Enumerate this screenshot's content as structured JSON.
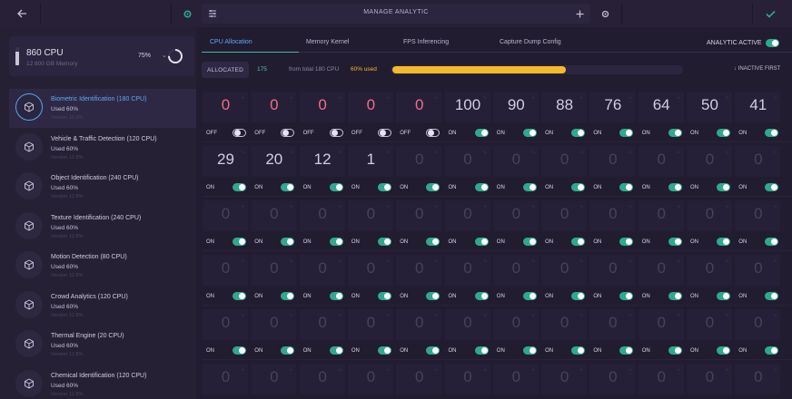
{
  "topbar": {
    "back_icon": "arrow-left-icon",
    "status_icon": "gear-icon",
    "menu_icon": "sliders-icon",
    "title": "MANAGE ANALYTIC",
    "add_icon": "plus-icon",
    "settings_icon": "gear-icon",
    "confirm_icon": "check-icon"
  },
  "cpu_card": {
    "title": "860 CPU",
    "memory": "12 800 GB Memory",
    "percent": "75%",
    "usage_fraction": 0.75
  },
  "analytics": [
    {
      "name": "Biometric Identification (180 CPU)",
      "used": "Used 60%",
      "version": "Version 12.8%",
      "active": true
    },
    {
      "name": "Vehicle & Traffic Detection (120 CPU)",
      "used": "Used 60%",
      "version": "Version 12.8%",
      "active": false
    },
    {
      "name": "Object Identification (240 CPU)",
      "used": "Used 60%",
      "version": "Version 12.8%",
      "active": false
    },
    {
      "name": "Texture Identification (240 CPU)",
      "used": "Used 60%",
      "version": "Version 12.8%",
      "active": false
    },
    {
      "name": "Motion Detection (80 CPU)",
      "used": "Used 60%",
      "version": "Version 12.8%",
      "active": false
    },
    {
      "name": "Crowd Analytics (120 CPU)",
      "used": "Used 60%",
      "version": "Version 12.8%",
      "active": false
    },
    {
      "name": "Thermal Engine (20 CPU)",
      "used": "Used 60%",
      "version": "Version 12.8%",
      "active": false
    },
    {
      "name": "Chemical Identification (120 CPU)",
      "used": "Used 60%",
      "version": "Version 12.8%",
      "active": false
    }
  ],
  "tabs": [
    {
      "label": "CPU Allocation",
      "active": true
    },
    {
      "label": "Memory Kernel",
      "active": false
    },
    {
      "label": "FPS Inferencing",
      "active": false
    },
    {
      "label": "Capture Dump Config",
      "active": false
    }
  ],
  "analytic_active": {
    "label": "ANALYTIC ACTIVE",
    "on": true
  },
  "allocation": {
    "chip": "ALLOCATED",
    "count": "175",
    "total": "from total 180 CPU",
    "used": "60% used",
    "used_fraction": 0.6,
    "sort_label": "↓ INACTIVE FIRST"
  },
  "grid": {
    "on_label": "ON",
    "off_label": "OFF",
    "cell_tag": "%",
    "rows": [
      [
        {
          "v": "0",
          "style": "red",
          "on": false
        },
        {
          "v": "0",
          "style": "red",
          "on": false
        },
        {
          "v": "0",
          "style": "red",
          "on": false
        },
        {
          "v": "0",
          "style": "red",
          "on": false
        },
        {
          "v": "0",
          "style": "red",
          "on": false
        },
        {
          "v": "100",
          "style": "normal",
          "on": true
        },
        {
          "v": "90",
          "style": "normal",
          "on": true
        },
        {
          "v": "88",
          "style": "normal",
          "on": true
        },
        {
          "v": "76",
          "style": "normal",
          "on": true
        },
        {
          "v": "64",
          "style": "normal",
          "on": true
        },
        {
          "v": "50",
          "style": "normal",
          "on": true
        },
        {
          "v": "41",
          "style": "normal",
          "on": true
        }
      ],
      [
        {
          "v": "29",
          "style": "normal",
          "on": true
        },
        {
          "v": "20",
          "style": "normal",
          "on": true
        },
        {
          "v": "12",
          "style": "normal",
          "on": true
        },
        {
          "v": "1",
          "style": "normal",
          "on": true
        },
        {
          "v": "0",
          "style": "dim",
          "on": true
        },
        {
          "v": "0",
          "style": "dim",
          "on": true
        },
        {
          "v": "0",
          "style": "dim",
          "on": true
        },
        {
          "v": "0",
          "style": "dim",
          "on": true
        },
        {
          "v": "0",
          "style": "dim",
          "on": true
        },
        {
          "v": "0",
          "style": "dim",
          "on": true
        },
        {
          "v": "0",
          "style": "dim",
          "on": true
        },
        {
          "v": "0",
          "style": "dim",
          "on": true
        }
      ],
      [
        {
          "v": "0",
          "style": "dim",
          "on": true
        },
        {
          "v": "0",
          "style": "dim",
          "on": true
        },
        {
          "v": "0",
          "style": "dim",
          "on": true
        },
        {
          "v": "0",
          "style": "dim",
          "on": true
        },
        {
          "v": "0",
          "style": "dim",
          "on": true
        },
        {
          "v": "0",
          "style": "dim",
          "on": true
        },
        {
          "v": "0",
          "style": "dim",
          "on": true
        },
        {
          "v": "0",
          "style": "dim",
          "on": true
        },
        {
          "v": "0",
          "style": "dim",
          "on": true
        },
        {
          "v": "0",
          "style": "dim",
          "on": true
        },
        {
          "v": "0",
          "style": "dim",
          "on": true
        },
        {
          "v": "0",
          "style": "dim",
          "on": true
        }
      ],
      [
        {
          "v": "0",
          "style": "dim",
          "on": true
        },
        {
          "v": "0",
          "style": "dim",
          "on": true
        },
        {
          "v": "0",
          "style": "dim",
          "on": true
        },
        {
          "v": "0",
          "style": "dim",
          "on": true
        },
        {
          "v": "0",
          "style": "dim",
          "on": true
        },
        {
          "v": "0",
          "style": "dim",
          "on": true
        },
        {
          "v": "0",
          "style": "dim",
          "on": true
        },
        {
          "v": "0",
          "style": "dim",
          "on": true
        },
        {
          "v": "0",
          "style": "dim",
          "on": true
        },
        {
          "v": "0",
          "style": "dim",
          "on": true
        },
        {
          "v": "0",
          "style": "dim",
          "on": true
        },
        {
          "v": "0",
          "style": "dim",
          "on": true
        }
      ],
      [
        {
          "v": "0",
          "style": "dim",
          "on": true
        },
        {
          "v": "0",
          "style": "dim",
          "on": true
        },
        {
          "v": "0",
          "style": "dim",
          "on": true
        },
        {
          "v": "0",
          "style": "dim",
          "on": true
        },
        {
          "v": "0",
          "style": "dim",
          "on": true
        },
        {
          "v": "0",
          "style": "dim",
          "on": true
        },
        {
          "v": "0",
          "style": "dim",
          "on": true
        },
        {
          "v": "0",
          "style": "dim",
          "on": true
        },
        {
          "v": "0",
          "style": "dim",
          "on": true
        },
        {
          "v": "0",
          "style": "dim",
          "on": true
        },
        {
          "v": "0",
          "style": "dim",
          "on": true
        },
        {
          "v": "0",
          "style": "dim",
          "on": true
        }
      ],
      [
        {
          "v": "0",
          "style": "dim",
          "on": true
        },
        {
          "v": "0",
          "style": "dim",
          "on": true
        },
        {
          "v": "0",
          "style": "dim",
          "on": true
        },
        {
          "v": "0",
          "style": "dim",
          "on": true
        },
        {
          "v": "0",
          "style": "dim",
          "on": true
        },
        {
          "v": "0",
          "style": "dim",
          "on": true
        },
        {
          "v": "0",
          "style": "dim",
          "on": true
        },
        {
          "v": "0",
          "style": "dim",
          "on": true
        },
        {
          "v": "0",
          "style": "dim",
          "on": true
        },
        {
          "v": "0",
          "style": "dim",
          "on": true
        },
        {
          "v": "0",
          "style": "dim",
          "on": true
        },
        {
          "v": "0",
          "style": "dim",
          "on": true
        }
      ]
    ]
  },
  "colors": {
    "accent_blue": "#5fa9f2",
    "toggle_on": "#2fa88e",
    "alert_red": "#ef6e86",
    "progress_yellow": "#f5b92b"
  }
}
